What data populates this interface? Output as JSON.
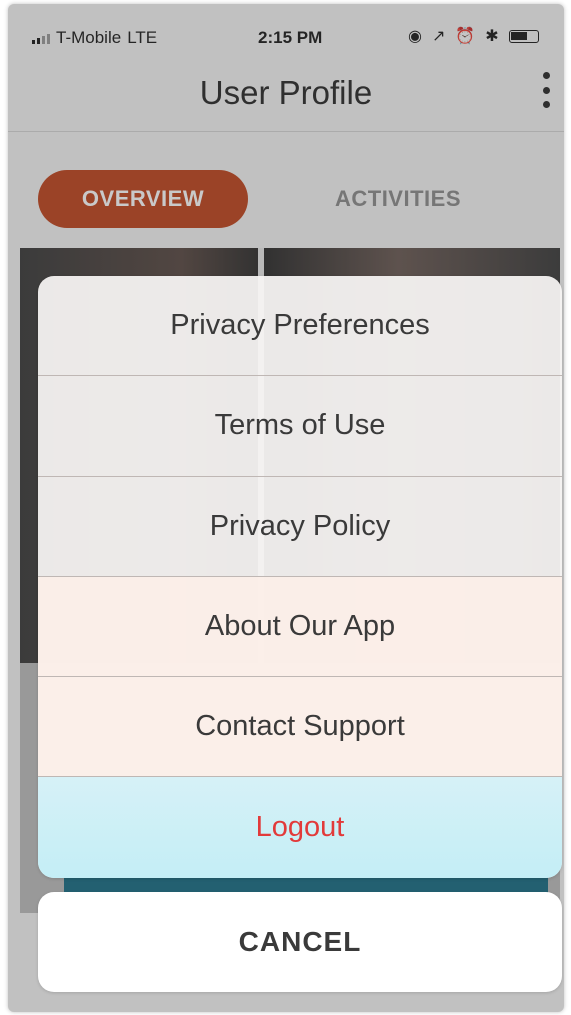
{
  "status_bar": {
    "carrier": "T-Mobile",
    "network": "LTE",
    "time": "2:15 PM",
    "icons": [
      "signal-icon",
      "location-icon",
      "alarm-icon",
      "bluetooth-icon",
      "battery-icon"
    ]
  },
  "nav": {
    "title": "User Profile",
    "menu_icon": "kebab-menu-icon"
  },
  "tabs": [
    {
      "label": "OVERVIEW",
      "active": true
    },
    {
      "label": "ACTIVITIES",
      "active": false
    }
  ],
  "action_sheet": {
    "items": [
      {
        "label": "Privacy Preferences"
      },
      {
        "label": "Terms of Use"
      },
      {
        "label": "Privacy Policy"
      },
      {
        "label": "About Our App"
      },
      {
        "label": "Contact Support"
      },
      {
        "label": "Logout",
        "destructive": true
      }
    ],
    "cancel_label": "CANCEL"
  },
  "colors": {
    "accent": "#c0461f",
    "destructive": "#e23a3a",
    "teal": "#1a6e86"
  }
}
